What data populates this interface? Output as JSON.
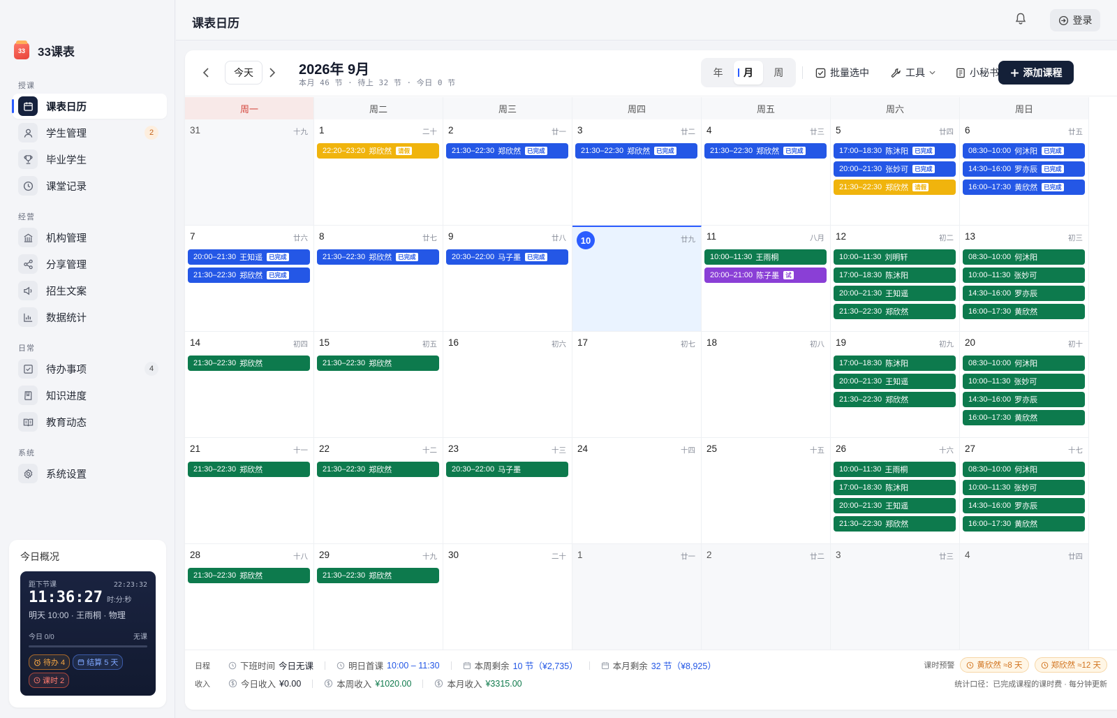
{
  "brand": {
    "logo_text": "33",
    "name": "33课表"
  },
  "sidebar": {
    "sections": [
      {
        "label": "授课",
        "top": 0
      },
      {
        "label": "经营"
      },
      {
        "label": "日常"
      },
      {
        "label": "系统"
      }
    ],
    "items": [
      {
        "label": "课表日历",
        "icon": "calendar-icon",
        "active": true
      },
      {
        "label": "学生管理",
        "icon": "user-icon",
        "badge": "2"
      },
      {
        "label": "毕业学生",
        "icon": "trophy-icon"
      },
      {
        "label": "课堂记录",
        "icon": "clock-icon"
      },
      {
        "label": "机构管理",
        "icon": "building-icon"
      },
      {
        "label": "分享管理",
        "icon": "share-icon"
      },
      {
        "label": "招生文案",
        "icon": "megaphone-icon"
      },
      {
        "label": "数据统计",
        "icon": "chart-icon"
      },
      {
        "label": "待办事项",
        "icon": "checkbox-icon",
        "badge": "4"
      },
      {
        "label": "知识进度",
        "icon": "book-icon"
      },
      {
        "label": "教育动态",
        "icon": "news-icon"
      },
      {
        "label": "系统设置",
        "icon": "gear-icon"
      }
    ]
  },
  "overview": {
    "title": "今日概况",
    "next_label": "距下节课",
    "now_time": "22:23:32",
    "countdown": "11:36:27",
    "countdown_unit": "时:分:秒",
    "next_lesson": "明天 10:00 · 王雨桐 · 物理",
    "today_label": "今日 0/0",
    "today_status": "无课",
    "chips": [
      {
        "text": "待办 4",
        "tone": "orange"
      },
      {
        "text": "结算 5 天",
        "tone": "blue"
      },
      {
        "text": "课时 2",
        "tone": "red"
      }
    ]
  },
  "header": {
    "title": "课表日历",
    "login": "登录"
  },
  "toolbar": {
    "today": "今天",
    "month_title": "2026年 9月",
    "month_sub": "本月 46 节 · 待上 32 节 · 今日 0 节",
    "views": [
      "年",
      "月",
      "周"
    ],
    "active_view": "月",
    "batch": "批量选中",
    "tools": "工具",
    "secretary": "小秘书",
    "add": "添加课程"
  },
  "weekdays": [
    "周一",
    "周二",
    "周三",
    "周四",
    "周五",
    "周六",
    "周日"
  ],
  "colors": {
    "blue": "#2457e6",
    "green": "#0d7a4d",
    "yellow": "#f0b40d",
    "purple": "#8a3fd6"
  },
  "calendar": [
    [
      {
        "d": "31",
        "l": "十九",
        "other": true,
        "ev": []
      },
      {
        "d": "1",
        "l": "二十",
        "ev": [
          {
            "t": "22:20–23:20",
            "n": "郑欣然",
            "c": "yellow",
            "tag": "请假"
          }
        ]
      },
      {
        "d": "2",
        "l": "廿一",
        "ev": [
          {
            "t": "21:30–22:30",
            "n": "郑欣然",
            "c": "blue",
            "tag": "已完成"
          }
        ]
      },
      {
        "d": "3",
        "l": "廿二",
        "ev": [
          {
            "t": "21:30–22:30",
            "n": "郑欣然",
            "c": "blue",
            "tag": "已完成"
          }
        ]
      },
      {
        "d": "4",
        "l": "廿三",
        "ev": [
          {
            "t": "21:30–22:30",
            "n": "郑欣然",
            "c": "blue",
            "tag": "已完成"
          }
        ]
      },
      {
        "d": "5",
        "l": "廿四",
        "ev": [
          {
            "t": "17:00–18:30",
            "n": "陈沐阳",
            "c": "blue",
            "tag": "已完成"
          },
          {
            "t": "20:00–21:30",
            "n": "张妙可",
            "c": "blue",
            "tag": "已完成"
          },
          {
            "t": "21:30–22:30",
            "n": "郑欣然",
            "c": "yellow",
            "tag": "请假"
          }
        ]
      },
      {
        "d": "6",
        "l": "廿五",
        "ev": [
          {
            "t": "08:30–10:00",
            "n": "何沐阳",
            "c": "blue",
            "tag": "已完成"
          },
          {
            "t": "14:30–16:00",
            "n": "罗亦辰",
            "c": "blue",
            "tag": "已完成"
          },
          {
            "t": "16:00–17:30",
            "n": "黄欣然",
            "c": "blue",
            "tag": "已完成"
          }
        ]
      }
    ],
    [
      {
        "d": "7",
        "l": "廿六",
        "ev": [
          {
            "t": "20:00–21:30",
            "n": "王知遥",
            "c": "blue",
            "tag": "已完成"
          },
          {
            "t": "21:30–22:30",
            "n": "郑欣然",
            "c": "blue",
            "tag": "已完成"
          }
        ]
      },
      {
        "d": "8",
        "l": "廿七",
        "ev": [
          {
            "t": "21:30–22:30",
            "n": "郑欣然",
            "c": "blue",
            "tag": "已完成"
          }
        ]
      },
      {
        "d": "9",
        "l": "廿八",
        "ev": [
          {
            "t": "20:30–22:00",
            "n": "马子墨",
            "c": "blue",
            "tag": "已完成"
          }
        ]
      },
      {
        "d": "10",
        "l": "廿九",
        "today": true,
        "ev": []
      },
      {
        "d": "11",
        "l": "八月",
        "ev": [
          {
            "t": "10:00–11:30",
            "n": "王雨桐",
            "c": "green"
          },
          {
            "t": "20:00–21:00",
            "n": "陈子墨",
            "c": "purple",
            "tag": "试"
          }
        ]
      },
      {
        "d": "12",
        "l": "初二",
        "ev": [
          {
            "t": "10:00–11:30",
            "n": "刘明轩",
            "c": "green"
          },
          {
            "t": "17:00–18:30",
            "n": "陈沐阳",
            "c": "green"
          },
          {
            "t": "20:00–21:30",
            "n": "王知遥",
            "c": "green"
          },
          {
            "t": "21:30–22:30",
            "n": "郑欣然",
            "c": "green"
          }
        ]
      },
      {
        "d": "13",
        "l": "初三",
        "ev": [
          {
            "t": "08:30–10:00",
            "n": "何沐阳",
            "c": "green"
          },
          {
            "t": "10:00–11:30",
            "n": "张妙可",
            "c": "green"
          },
          {
            "t": "14:30–16:00",
            "n": "罗亦辰",
            "c": "green"
          },
          {
            "t": "16:00–17:30",
            "n": "黄欣然",
            "c": "green"
          }
        ]
      }
    ],
    [
      {
        "d": "14",
        "l": "初四",
        "ev": [
          {
            "t": "21:30–22:30",
            "n": "郑欣然",
            "c": "green"
          }
        ]
      },
      {
        "d": "15",
        "l": "初五",
        "ev": [
          {
            "t": "21:30–22:30",
            "n": "郑欣然",
            "c": "green"
          }
        ]
      },
      {
        "d": "16",
        "l": "初六",
        "ev": []
      },
      {
        "d": "17",
        "l": "初七",
        "ev": []
      },
      {
        "d": "18",
        "l": "初八",
        "ev": []
      },
      {
        "d": "19",
        "l": "初九",
        "ev": [
          {
            "t": "17:00–18:30",
            "n": "陈沐阳",
            "c": "green"
          },
          {
            "t": "20:00–21:30",
            "n": "王知遥",
            "c": "green"
          },
          {
            "t": "21:30–22:30",
            "n": "郑欣然",
            "c": "green"
          }
        ]
      },
      {
        "d": "20",
        "l": "初十",
        "ev": [
          {
            "t": "08:30–10:00",
            "n": "何沐阳",
            "c": "green"
          },
          {
            "t": "10:00–11:30",
            "n": "张妙可",
            "c": "green"
          },
          {
            "t": "14:30–16:00",
            "n": "罗亦辰",
            "c": "green"
          },
          {
            "t": "16:00–17:30",
            "n": "黄欣然",
            "c": "green"
          }
        ]
      }
    ],
    [
      {
        "d": "21",
        "l": "十一",
        "ev": [
          {
            "t": "21:30–22:30",
            "n": "郑欣然",
            "c": "green"
          }
        ]
      },
      {
        "d": "22",
        "l": "十二",
        "ev": [
          {
            "t": "21:30–22:30",
            "n": "郑欣然",
            "c": "green"
          }
        ]
      },
      {
        "d": "23",
        "l": "十三",
        "ev": [
          {
            "t": "20:30–22:00",
            "n": "马子墨",
            "c": "green"
          }
        ]
      },
      {
        "d": "24",
        "l": "十四",
        "ev": []
      },
      {
        "d": "25",
        "l": "十五",
        "ev": []
      },
      {
        "d": "26",
        "l": "十六",
        "ev": [
          {
            "t": "10:00–11:30",
            "n": "王雨桐",
            "c": "green"
          },
          {
            "t": "17:00–18:30",
            "n": "陈沐阳",
            "c": "green"
          },
          {
            "t": "20:00–21:30",
            "n": "王知遥",
            "c": "green"
          },
          {
            "t": "21:30–22:30",
            "n": "郑欣然",
            "c": "green"
          }
        ]
      },
      {
        "d": "27",
        "l": "十七",
        "ev": [
          {
            "t": "08:30–10:00",
            "n": "何沐阳",
            "c": "green"
          },
          {
            "t": "10:00–11:30",
            "n": "张妙可",
            "c": "green"
          },
          {
            "t": "14:30–16:00",
            "n": "罗亦辰",
            "c": "green"
          },
          {
            "t": "16:00–17:30",
            "n": "黄欣然",
            "c": "green"
          }
        ]
      }
    ],
    [
      {
        "d": "28",
        "l": "十八",
        "ev": [
          {
            "t": "21:30–22:30",
            "n": "郑欣然",
            "c": "green"
          }
        ]
      },
      {
        "d": "29",
        "l": "十九",
        "ev": [
          {
            "t": "21:30–22:30",
            "n": "郑欣然",
            "c": "green"
          }
        ]
      },
      {
        "d": "30",
        "l": "二十",
        "ev": []
      },
      {
        "d": "1",
        "l": "廿一",
        "other": true,
        "ev": []
      },
      {
        "d": "2",
        "l": "廿二",
        "other": true,
        "ev": []
      },
      {
        "d": "3",
        "l": "廿三",
        "other": true,
        "ev": []
      },
      {
        "d": "4",
        "l": "廿四",
        "other": true,
        "ev": []
      }
    ]
  ],
  "footer": {
    "row1_label": "日程",
    "row1": [
      {
        "icon": "clock-icon",
        "label": "下班时间",
        "value": "今日无课",
        "tone": "dark"
      },
      {
        "icon": "clock-icon",
        "label": "明日首课",
        "value": "10:00 – 11:30",
        "tone": "blue"
      },
      {
        "icon": "calendar-icon",
        "label": "本周剩余",
        "value": "10 节（¥2,735）",
        "tone": "blue"
      },
      {
        "icon": "calendar-icon",
        "label": "本月剩余",
        "value": "32 节（¥8,925）",
        "tone": "blue"
      }
    ],
    "row2_label": "收入",
    "row2": [
      {
        "icon": "coin-icon",
        "label": "今日收入",
        "value": "¥0.00",
        "tone": "dark"
      },
      {
        "icon": "coin-icon",
        "label": "本周收入",
        "value": "¥1020.00",
        "tone": "green"
      },
      {
        "icon": "coin-icon",
        "label": "本月收入",
        "value": "¥3315.00",
        "tone": "green"
      }
    ],
    "warn_label": "课时预警",
    "warnings": [
      "黄欣然 ≈8 天",
      "郑欣然 ≈12 天"
    ],
    "note": "统计口径：已完成课程的课时费 · 每分钟更新"
  }
}
